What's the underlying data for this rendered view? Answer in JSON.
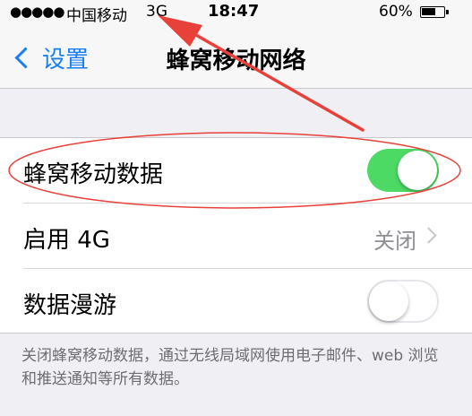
{
  "status_bar": {
    "signal": "●●●●●",
    "carrier": "中国移动",
    "network": "3G",
    "time": "18:47",
    "battery_percent": "60%"
  },
  "nav": {
    "back_label": "设置",
    "title": "蜂窝移动网络"
  },
  "rows": {
    "cellular_data": {
      "label": "蜂窝移动数据",
      "enabled": true
    },
    "enable_4g": {
      "label": "启用 4G",
      "value": "关闭"
    },
    "data_roaming": {
      "label": "数据漫游",
      "enabled": false
    }
  },
  "footer_note": "关闭蜂窝移动数据，通过无线局域网使用电子邮件、web 浏览和推送通知等所有数据。",
  "colors": {
    "accent": "#1a7ef5",
    "toggle_on": "#4cd964",
    "annotation": "#e8413a"
  }
}
